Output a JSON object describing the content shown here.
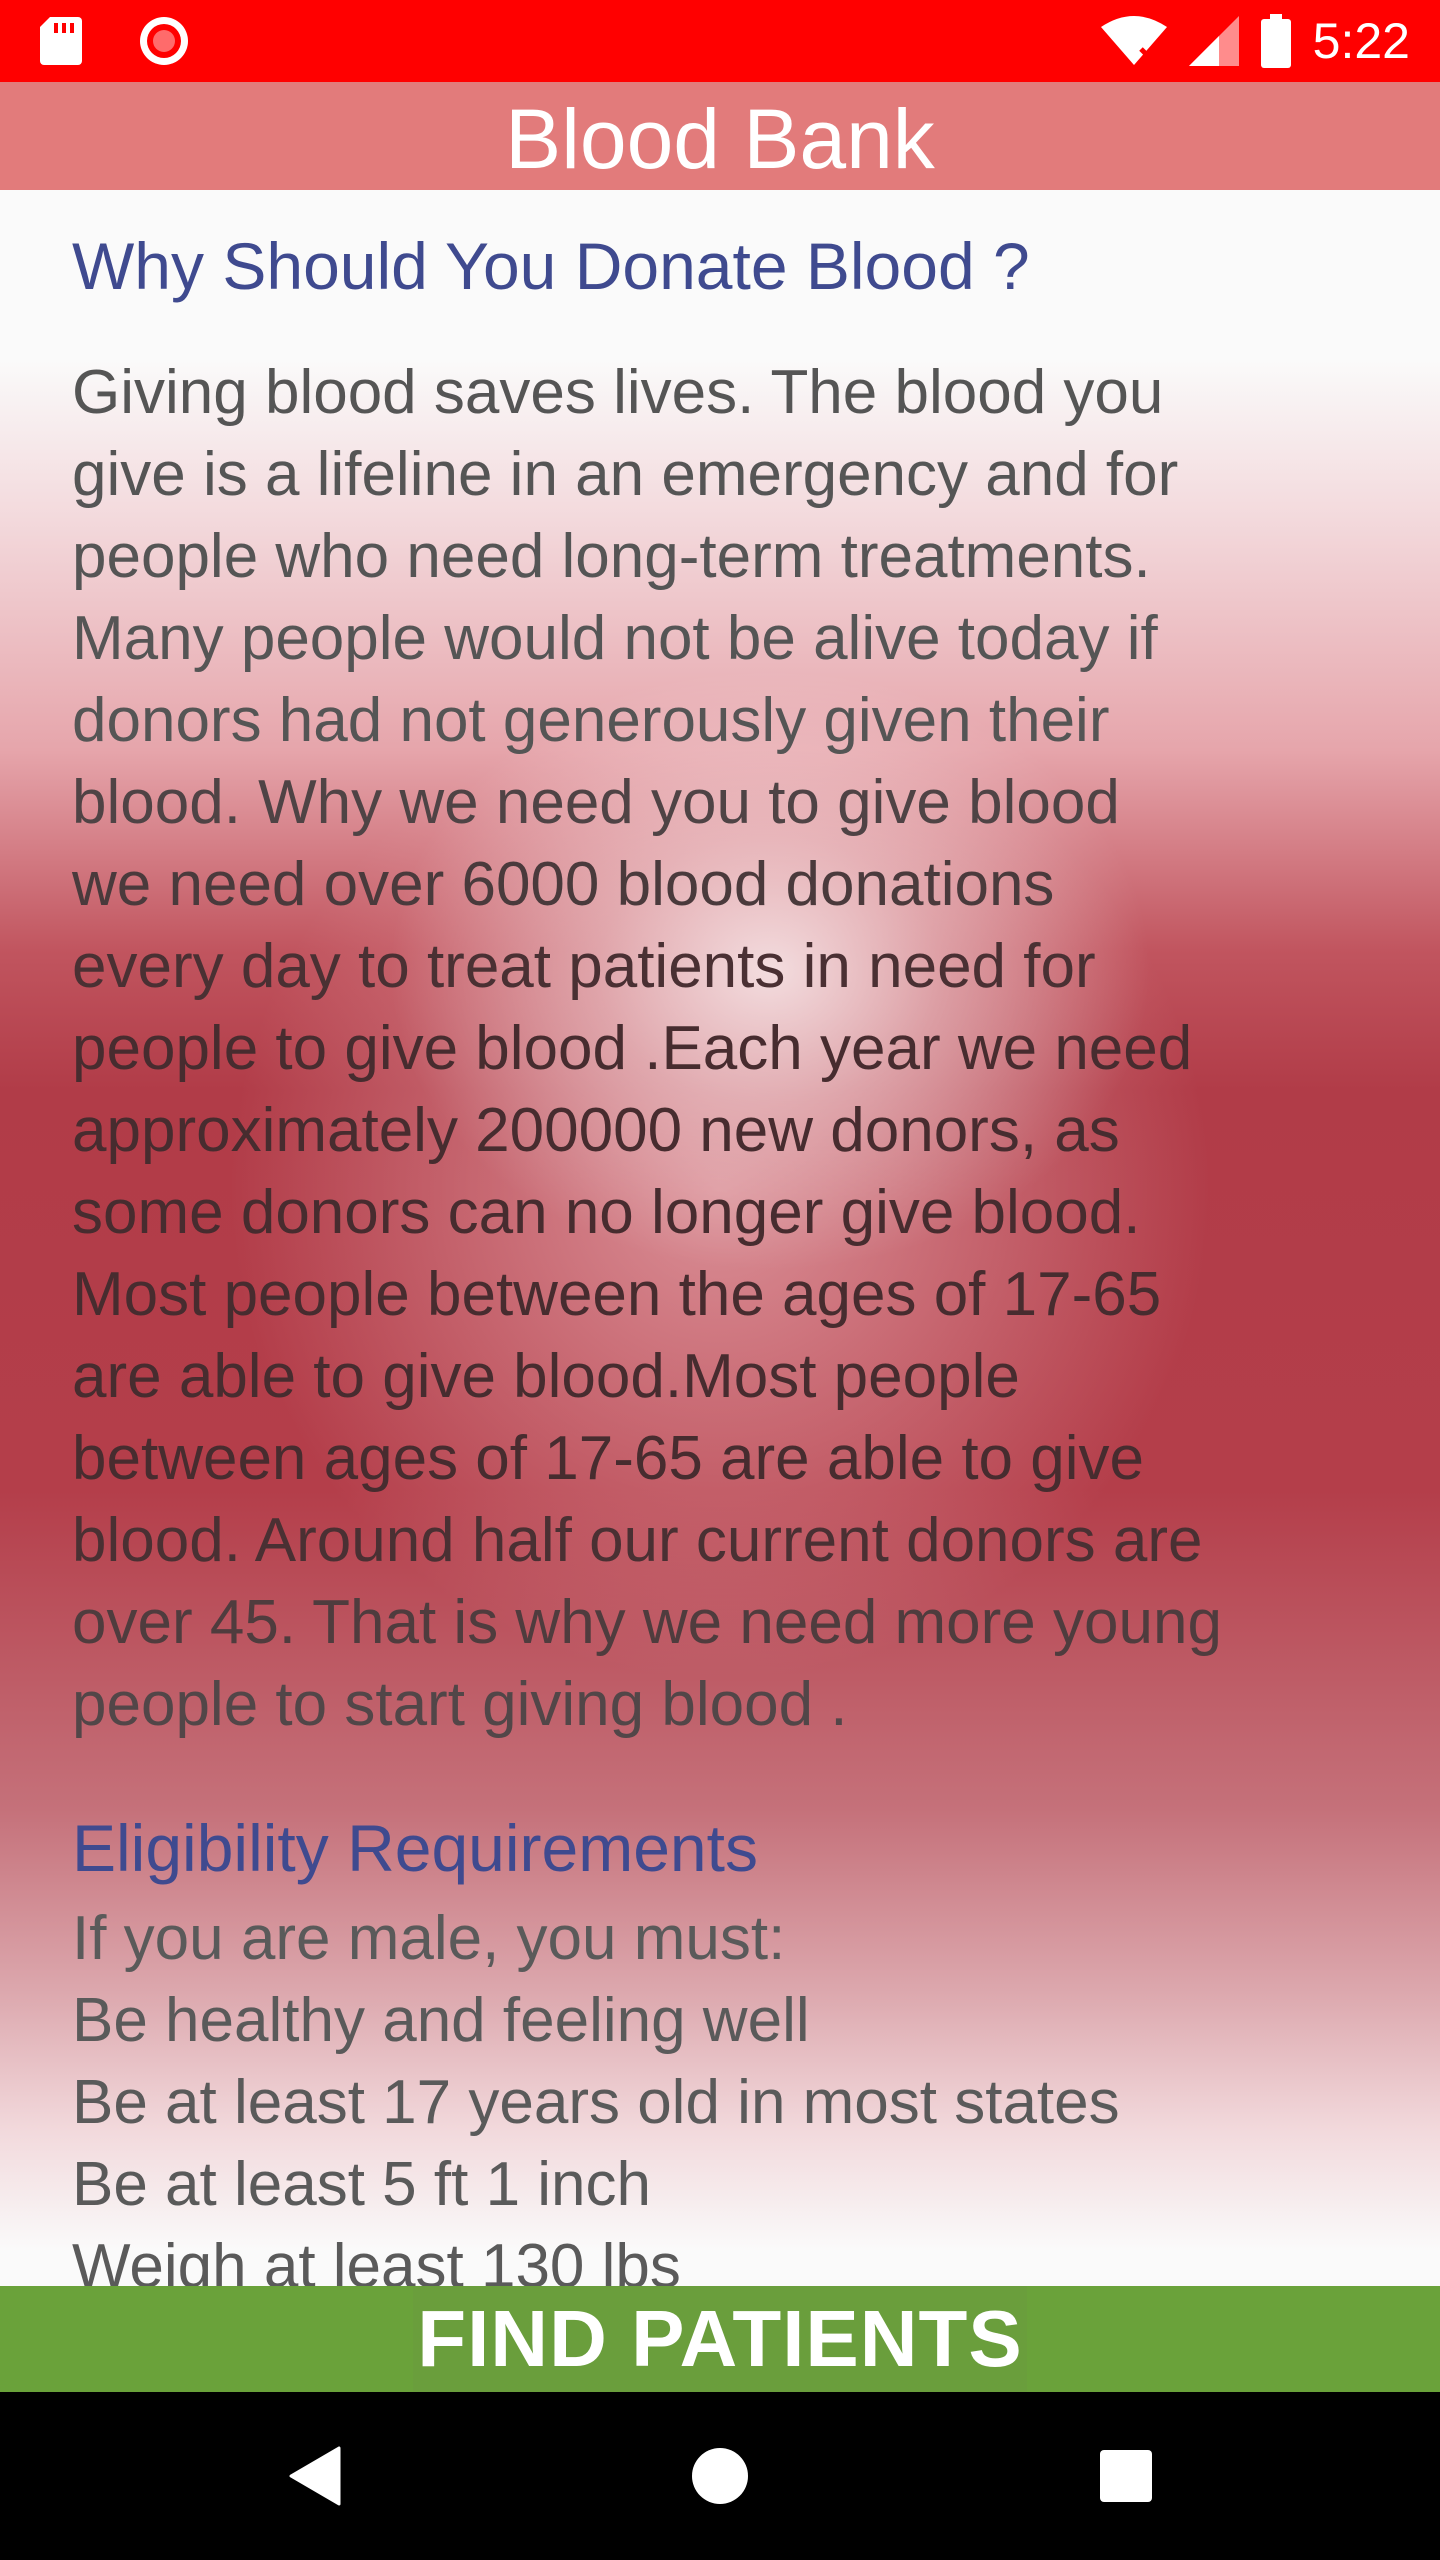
{
  "status_bar": {
    "time": "5:22",
    "left_icons": [
      "sd-card-icon",
      "record-icon"
    ],
    "right_icons": [
      "wifi-icon",
      "signal-icon",
      "battery-icon"
    ],
    "color": "#ff0000"
  },
  "app_bar": {
    "title": "Blood Bank",
    "color": "#e27b7b"
  },
  "content": {
    "heading": "Why Should You Donate Blood ?",
    "paragraph_lines": [
      "Giving blood saves lives. The blood you",
      "give is a lifeline in an emergency and for",
      "people who need long-term treatments.",
      "Many people would not be alive today if",
      "donors had not generously given their",
      "blood. Why we need you to give blood",
      "we need over 6000 blood donations",
      "every day to treat patients in need for",
      "people to give blood .Each year we need",
      "approximately 200000 new donors, as",
      "some donors can no longer give blood.",
      "Most people between the ages of 17-65",
      "are able to give blood.Most people",
      "between ages of 17-65 are able to give",
      "blood. Around half our current donors are",
      "over 45. That is why we need more young",
      "people to start giving blood ."
    ],
    "requirements_heading": "Eligibility Requirements",
    "requirements_lines": [
      "If you are male, you must:",
      "Be healthy and feeling well",
      "Be at least 17 years old in most states",
      "Be at least 5 ft 1 inch",
      "Weigh at least 130 lbs"
    ],
    "heading_color": "#3f4a8f"
  },
  "button": {
    "label": "FIND PATIENTS",
    "color": "#6aa23a"
  },
  "nav_bar": {
    "buttons": [
      "back-icon",
      "home-icon",
      "recents-icon"
    ]
  }
}
